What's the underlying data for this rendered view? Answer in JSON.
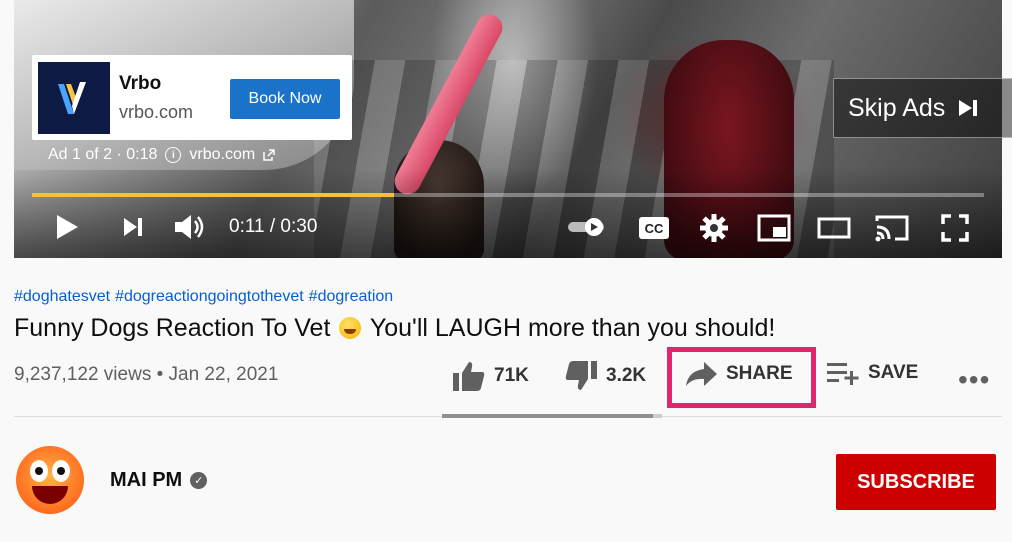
{
  "ad": {
    "advertiser": "Vrbo",
    "domain": "vrbo.com",
    "cta_label": "Book Now",
    "info": "Ad 1 of 2 · 0:18",
    "info_link": "vrbo.com",
    "skip_label": "Skip Ads"
  },
  "player": {
    "time_display": "0:11 / 0:30",
    "progress_fraction": 0.38,
    "accent_color": "#fbc02d"
  },
  "video": {
    "hashtags": [
      "#doghatesvet",
      "#dogreactiongoingtothevet",
      "#dogreation"
    ],
    "title_before": "Funny Dogs Reaction To Vet",
    "title_after": "You'll LAUGH more than you should!",
    "meta": "9,237,122 views • Jan 22, 2021"
  },
  "actions": {
    "likes": "71K",
    "dislikes": "3.2K",
    "share_label": "SHARE",
    "save_label": "SAVE",
    "like_fraction": 0.96,
    "highlight_color": "#e0266f"
  },
  "channel": {
    "name": "MAI PM",
    "subscribe_label": "SUBSCRIBE"
  }
}
